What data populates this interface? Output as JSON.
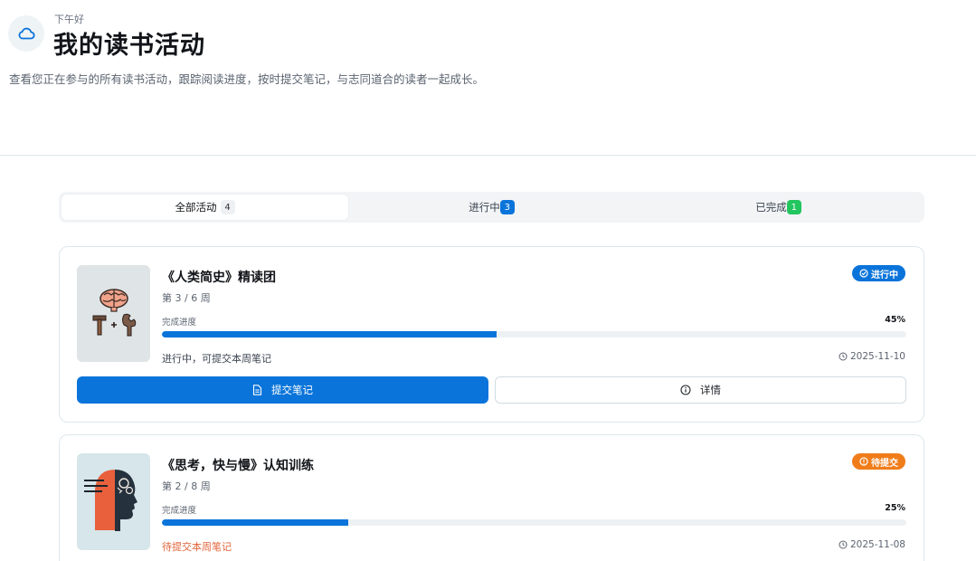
{
  "header": {
    "greeting": "下午好",
    "title": "我的读书活动",
    "subtitle": "查看您正在参与的所有读书活动，跟踪阅读进度，按时提交笔记，与志同道合的读者一起成长。",
    "icon": "cloud-icon"
  },
  "tabs": [
    {
      "label": "全部活动",
      "count": "4"
    },
    {
      "label": "进行中",
      "count": "3"
    },
    {
      "label": "已完成",
      "count": "1"
    }
  ],
  "cards": [
    {
      "title": "《人类简史》精读团",
      "week": "第 3 / 6 周",
      "progress_label": "完成进度",
      "progress_text": "45%",
      "progress": 45,
      "status": "进行中，可提交本周笔记",
      "date": "2025-11-10",
      "badge": "进行中",
      "badge_color": "#0a74da",
      "cover_icon": "brain-tools-icon",
      "primary_button": "提交笔记",
      "secondary_button": "详情"
    },
    {
      "title": "《思考，快与慢》认知训练",
      "week": "第 2 / 8 周",
      "progress_label": "完成进度",
      "progress_text": "25%",
      "progress": 25,
      "status": "待提交本周笔记",
      "status_color": "#e0643a",
      "date": "2025-11-08",
      "badge": "待提交",
      "badge_color": "#f07d1a",
      "cover_icon": "head-profile-icon"
    }
  ],
  "colors": {
    "accent": "#0a74da",
    "success": "#22c55e",
    "warning": "#f07d1a"
  }
}
